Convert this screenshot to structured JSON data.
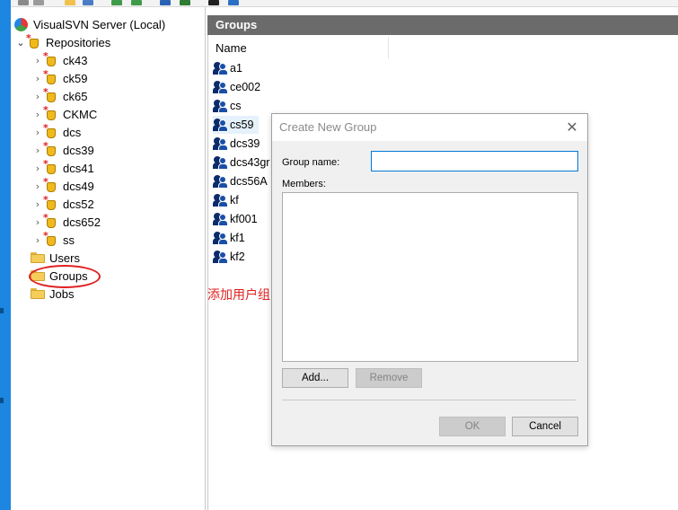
{
  "tree": {
    "server": "VisualSVN Server (Local)",
    "repositories_label": "Repositories",
    "repos": [
      "ck43",
      "ck59",
      "ck65",
      "CKMC",
      "dcs",
      "dcs39",
      "dcs41",
      "dcs49",
      "dcs52",
      "dcs652",
      "ss"
    ],
    "users_label": "Users",
    "groups_label": "Groups",
    "jobs_label": "Jobs"
  },
  "panel": {
    "title": "Groups",
    "column_name": "Name",
    "groups": [
      "a1",
      "ce002",
      "cs",
      "cs59",
      "dcs39",
      "dcs43gr",
      "dcs56A",
      "kf",
      "kf001",
      "kf1",
      "kf2"
    ],
    "selected": "cs59"
  },
  "annotation": {
    "text": "添加用户组",
    "color": "#e02020"
  },
  "dialog": {
    "title": "Create New Group",
    "close_icon": "close-icon",
    "group_name_label": "Group name:",
    "group_name_value": "",
    "members_label": "Members:",
    "add_button": "Add...",
    "remove_button": "Remove",
    "ok_button": "OK",
    "cancel_button": "Cancel"
  },
  "colors": {
    "header_bg": "#6b6b6b",
    "accent_blue": "#1c86e0",
    "input_focus": "#0078d7"
  }
}
